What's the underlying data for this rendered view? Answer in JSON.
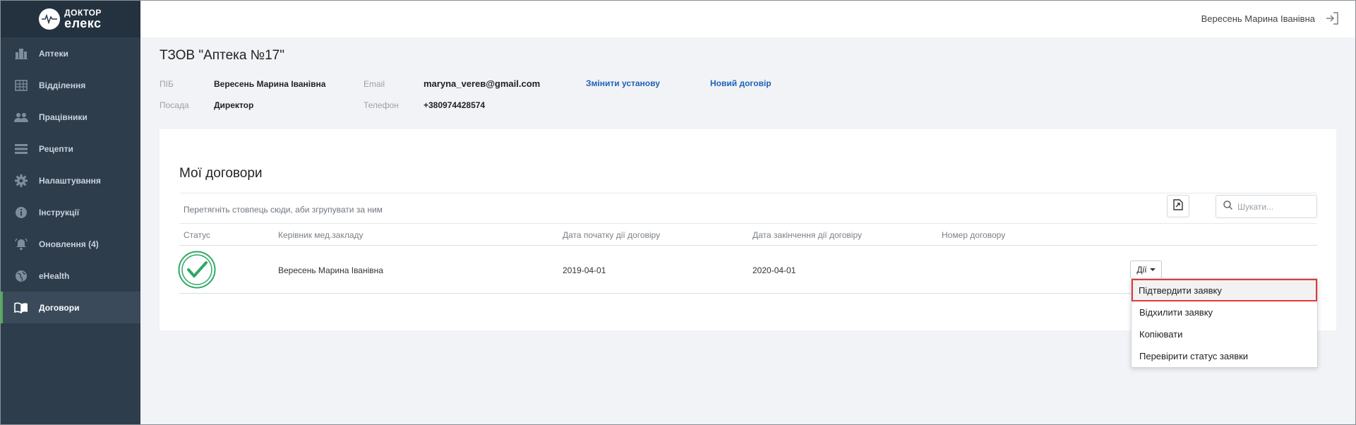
{
  "app": {
    "logo_line1": "ДОКТОР",
    "logo_line2": "елекс"
  },
  "sidebar": {
    "items": [
      {
        "label": "Аптеки",
        "icon": "building-icon"
      },
      {
        "label": "Відділення",
        "icon": "grid-building-icon"
      },
      {
        "label": "Працівники",
        "icon": "people-icon"
      },
      {
        "label": "Рецепти",
        "icon": "list-icon"
      },
      {
        "label": "Налаштування",
        "icon": "gear-icon"
      },
      {
        "label": "Інструкції",
        "icon": "info-icon"
      },
      {
        "label": "Оновлення (4)",
        "icon": "bell-icon"
      },
      {
        "label": "eHealth",
        "icon": "globe-icon"
      },
      {
        "label": "Договори",
        "icon": "book-icon",
        "active": true
      }
    ]
  },
  "topbar": {
    "user_name": "Вересень Марина Іванівна"
  },
  "header": {
    "org_title": "ТЗОВ \"Аптека №17\"",
    "pib_label": "ПІБ",
    "pib_value": "Вересень Марина Іванівна",
    "position_label": "Посада",
    "position_value": "Директор",
    "email_label": "Email",
    "email_value": "maryna_vereв@gmail.com",
    "phone_label": "Телефон",
    "phone_value": "+380974428574",
    "change_org_link": "Змінити установу",
    "new_contract_link": "Новий договір"
  },
  "contracts": {
    "title": "Мої договори",
    "group_hint": "Перетягніть стовпець сюди, аби згрупувати за ним",
    "search_placeholder": "Шукати...",
    "columns": [
      "Статус",
      "Керівник мед.закладу",
      "Дата початку дії договіру",
      "Дата закінчення дії договіру",
      "Номер договору"
    ],
    "rows": [
      {
        "status": "approved",
        "manager": "Вересень Марина Іванівна",
        "start_date": "2019-04-01",
        "end_date": "2020-04-01",
        "number": ""
      }
    ],
    "actions_label": "Дії"
  },
  "dropdown": {
    "items": [
      "Підтвердити заявку",
      "Відхилити заявку",
      "Копіювати",
      "Перевірити статус заявки"
    ]
  },
  "colors": {
    "sidebar_bg": "#2e3d4c",
    "active_accent": "#4caf50",
    "link": "#1e63b4",
    "highlight_border": "#e03a3a",
    "status_green": "#2fa866"
  }
}
